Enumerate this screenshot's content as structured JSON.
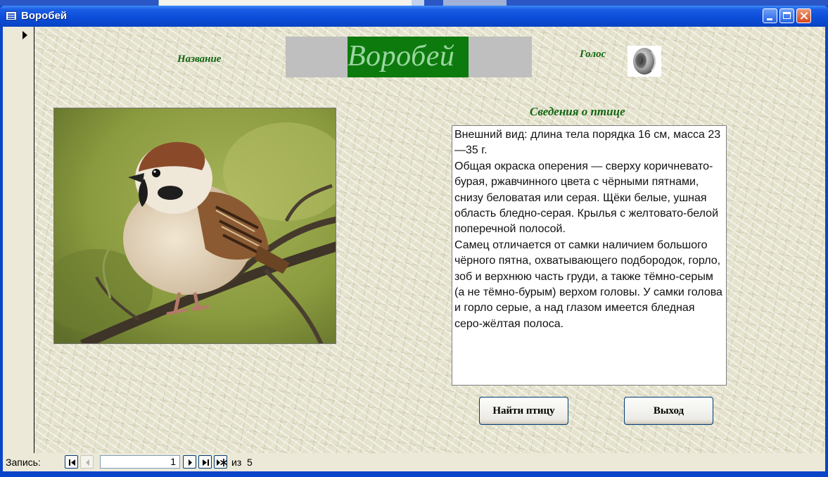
{
  "window": {
    "title": "Воробей"
  },
  "form": {
    "name_label": "Название",
    "name_value": "Воробей",
    "voice_label": "Голос",
    "info_label": "Сведения о птице",
    "info_text": "Внешний вид: длина тела порядка 16 см, масса 23—35 г.\nОбщая окраска оперения — сверху коричневато-бурая, ржавчинного цвета с чёрными пятнами, снизу беловатая или серая. Щёки белые, ушная область бледно-серая. Крылья с желтовато-белой поперечной полосой.\nСамец отличается от самки наличием большого чёрного пятна, охватывающего подбородок, горло, зоб и верхнюю часть груди, а также тёмно-серым (а не тёмно-бурым) верхом головы. У самки голова и горло серые, а над глазом имеется бледная серо-жёлтая полоса.",
    "find_button": "Найти птицу",
    "exit_button": "Выход"
  },
  "navigation": {
    "record_label": "Запись:",
    "current_record": "1",
    "of_label": "из",
    "total_records": "5"
  },
  "icons": {
    "window": "form-icon",
    "voice": "speaker-icon",
    "record_selector": "current-record-arrow-icon"
  },
  "colors": {
    "title_bar": "#0a4bd6",
    "label_green": "#116611",
    "name_highlight": "#0d7a0d",
    "name_text": "#9ad7a0"
  }
}
